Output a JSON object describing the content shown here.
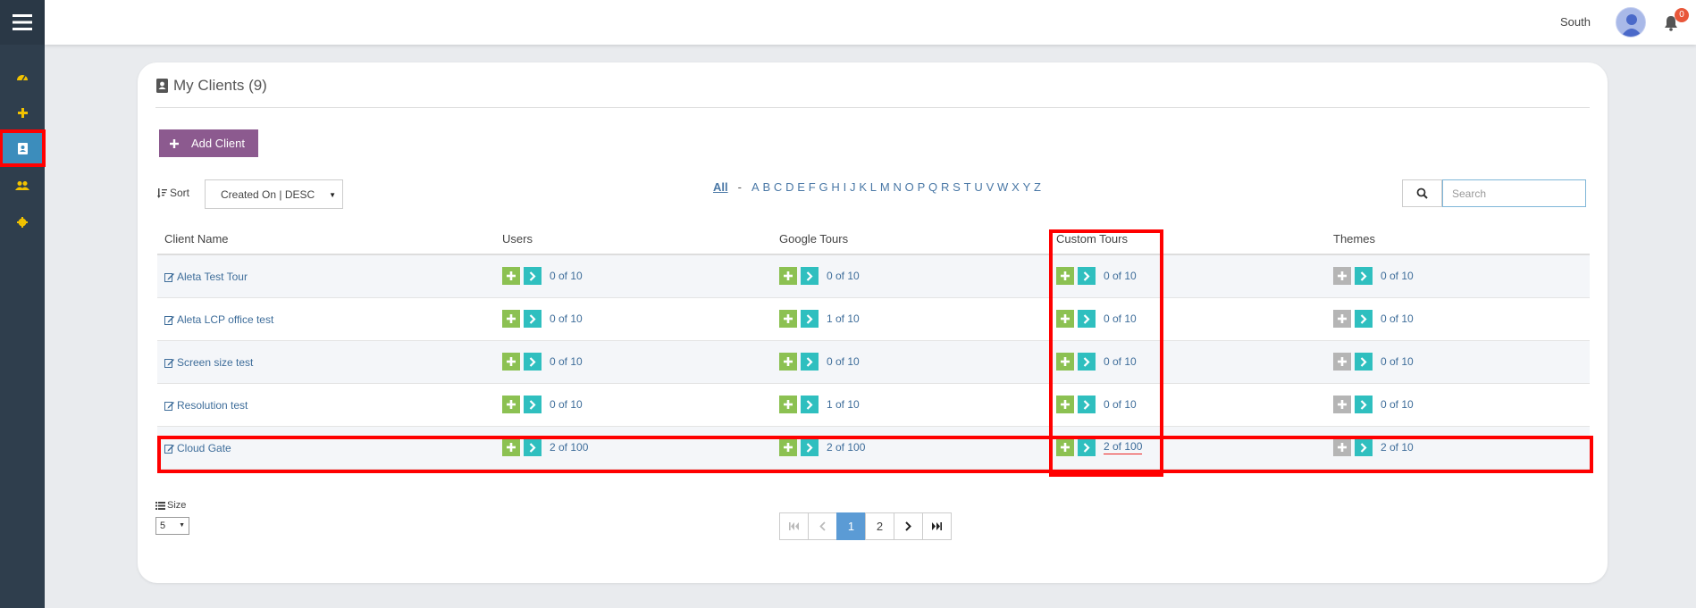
{
  "sidebar": {
    "items": [
      {
        "name": "dashboard",
        "icon": "dashboard-icon"
      },
      {
        "name": "add",
        "icon": "plus-icon"
      },
      {
        "name": "clients",
        "icon": "contact-book-icon",
        "active": true
      },
      {
        "name": "users",
        "icon": "users-icon"
      },
      {
        "name": "settings",
        "icon": "gear-icon"
      }
    ]
  },
  "header": {
    "user_name": "South",
    "notification_count": "0"
  },
  "page": {
    "title": "My Clients (9)",
    "add_button_label": "Add Client"
  },
  "sort": {
    "label": "Sort",
    "selected": "Created On | DESC"
  },
  "alphabet": {
    "all_label": "All",
    "separator": "-",
    "letters": [
      "A",
      "B",
      "C",
      "D",
      "E",
      "F",
      "G",
      "H",
      "I",
      "J",
      "K",
      "L",
      "M",
      "N",
      "O",
      "P",
      "Q",
      "R",
      "S",
      "T",
      "U",
      "V",
      "W",
      "X",
      "Y",
      "Z"
    ]
  },
  "search": {
    "placeholder": "Search"
  },
  "table": {
    "headers": {
      "client_name": "Client Name",
      "users": "Users",
      "google_tours": "Google Tours",
      "custom_tours": "Custom Tours",
      "themes": "Themes"
    },
    "rows": [
      {
        "name": "Aleta Test Tour",
        "users": "0 of 10",
        "google": "0 of 10",
        "custom": "0 of 10",
        "themes": "0 of 10"
      },
      {
        "name": "Aleta LCP office test",
        "users": "0 of 10",
        "google": "1 of 10",
        "custom": "0 of 10",
        "themes": "0 of 10"
      },
      {
        "name": "Screen size test",
        "users": "0 of 10",
        "google": "0 of 10",
        "custom": "0 of 10",
        "themes": "0 of 10"
      },
      {
        "name": "Resolution test",
        "users": "0 of 10",
        "google": "1 of 10",
        "custom": "0 of 10",
        "themes": "0 of 10"
      },
      {
        "name": "Cloud Gate",
        "users": "2 of 100",
        "google": "2 of 100",
        "custom": "2 of 100",
        "themes": "2 of 10"
      }
    ]
  },
  "size": {
    "label": "Size",
    "selected": "5"
  },
  "pagination": {
    "pages": [
      "1",
      "2"
    ],
    "current": "1"
  },
  "colors": {
    "sidebar_bg": "#2f3e4d",
    "active_blue": "#3c8dbc",
    "add_button": "#8c5a8f",
    "plus_green": "#8cc152",
    "arrow_teal": "#2fbfbf",
    "highlight_red": "#ff0000"
  }
}
